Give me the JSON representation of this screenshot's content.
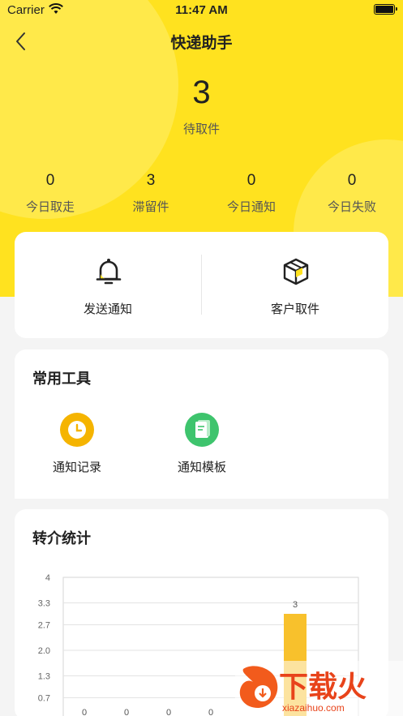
{
  "status": {
    "carrier": "Carrier",
    "time": "11:47 AM"
  },
  "header": {
    "title": "快递助手"
  },
  "summary": {
    "pending_count": "3",
    "pending_label": "待取件"
  },
  "stats": [
    {
      "value": "0",
      "label": "今日取走"
    },
    {
      "value": "3",
      "label": "滞留件"
    },
    {
      "value": "0",
      "label": "今日通知"
    },
    {
      "value": "0",
      "label": "今日失败"
    }
  ],
  "actions": [
    {
      "label": "发送通知",
      "icon": "bell-icon"
    },
    {
      "label": "客户取件",
      "icon": "package-icon"
    }
  ],
  "tools": {
    "title": "常用工具",
    "items": [
      {
        "label": "通知记录",
        "icon": "clock-icon",
        "color": "#f5b400"
      },
      {
        "label": "通知模板",
        "icon": "document-icon",
        "color": "#3ec46d"
      }
    ]
  },
  "referral": {
    "title": "转介统计"
  },
  "chart_data": {
    "type": "bar",
    "yticks": [
      "4",
      "3.3",
      "2.7",
      "2.0",
      "1.3",
      "0.7"
    ],
    "ylim": [
      0,
      4
    ],
    "categories": [
      "",
      "",
      "",
      "",
      "",
      "",
      ""
    ],
    "values": [
      0,
      0,
      0,
      0,
      0,
      3,
      0
    ],
    "data_labels": [
      "0",
      "0",
      "0",
      "0",
      "",
      "3",
      ""
    ],
    "bar_color": "#f8c12c"
  },
  "watermark": {
    "text": "下载火",
    "site": "xiazaihuo.com"
  },
  "colors": {
    "brand": "#ffe21f",
    "accent": "#f8c12c"
  }
}
